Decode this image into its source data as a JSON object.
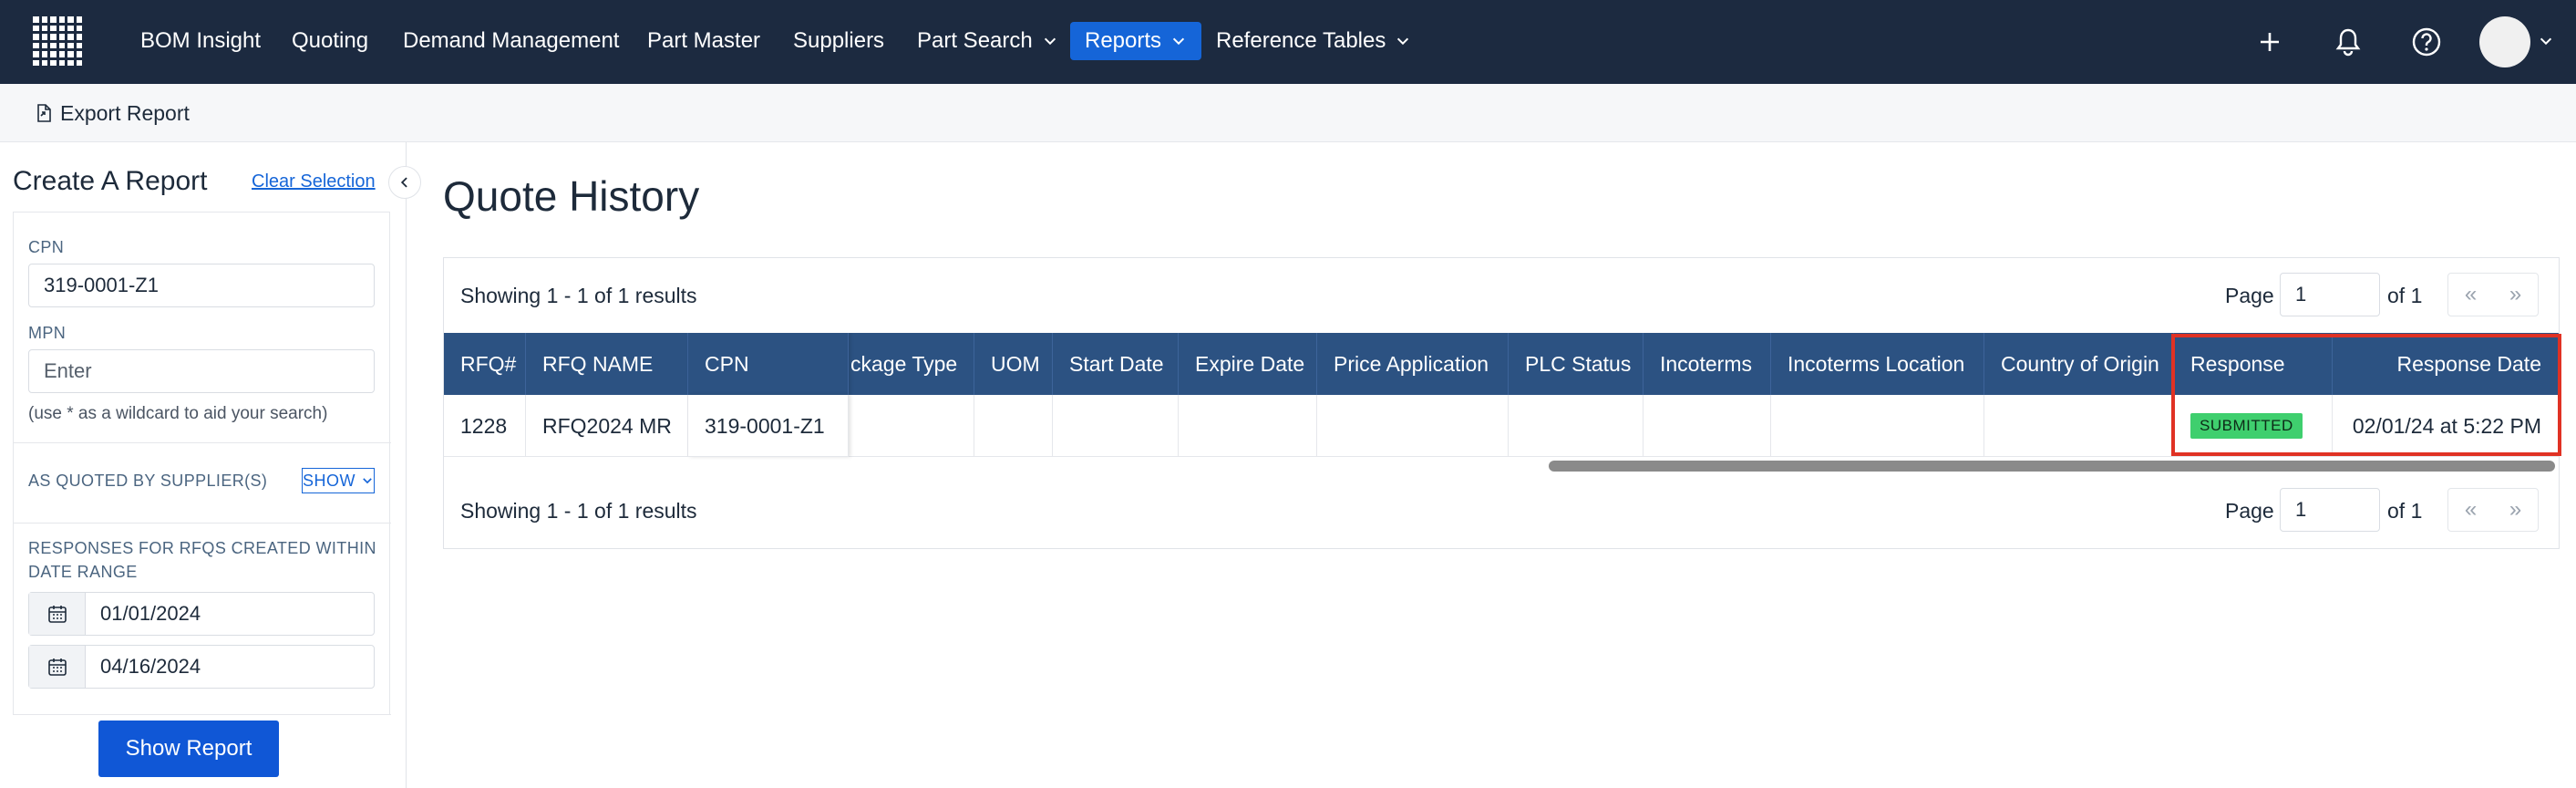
{
  "nav": {
    "items": [
      {
        "label": "BOM Insight"
      },
      {
        "label": "Quoting"
      },
      {
        "label": "Demand Management"
      },
      {
        "label": "Part Master"
      },
      {
        "label": "Suppliers"
      },
      {
        "label": "Part Search"
      },
      {
        "label": "Reports",
        "active": true
      },
      {
        "label": "Reference Tables"
      }
    ],
    "icons": [
      "plus-icon",
      "bell-icon",
      "help-icon",
      "avatar"
    ],
    "accent_color": "#1565d8",
    "bar_color": "#1c2a40"
  },
  "toolbar": {
    "export_label": "Export Report"
  },
  "sidebar": {
    "title": "Create A Report",
    "clear_label": "Clear Selection",
    "cpn": {
      "label": "CPN",
      "value": "319-0001-Z1"
    },
    "mpn": {
      "label": "MPN",
      "placeholder": "Enter",
      "hint": "(use * as a wildcard to aid your search)"
    },
    "quoted_by": {
      "label": "AS QUOTED BY SUPPLIER(S)",
      "toggle_label": "SHOW"
    },
    "date_range": {
      "label_line1": "RESPONSES FOR RFQS CREATED WITHIN",
      "label_line2": "DATE RANGE",
      "start": "01/01/2024",
      "end": "04/16/2024"
    },
    "submit_label": "Show Report"
  },
  "main": {
    "title": "Quote History",
    "showing_top": "Showing 1 - 1 of 1 results",
    "showing_bottom": "Showing 1 - 1 of 1 results",
    "page_label": "Page",
    "page_value": "1",
    "page_of": "of 1",
    "prev_label": "«",
    "next_label": "»",
    "table": {
      "columns": [
        "RFQ#",
        "RFQ NAME",
        "CPN",
        "ckage Type",
        "UOM",
        "Start Date",
        "Expire Date",
        "Price Application",
        "PLC Status",
        "Incoterms",
        "Incoterms Location",
        "Country of Origin",
        "Response",
        "Response Date"
      ],
      "rows": [
        {
          "rfq": "1228",
          "rfq_name": "RFQ2024 MR",
          "cpn": "319-0001-Z1",
          "package_type": "",
          "uom": "",
          "start_date": "",
          "expire_date": "",
          "price_application": "",
          "plc_status": "",
          "incoterms": "",
          "incoterms_location": "",
          "country_of_origin": "",
          "response": "SUBMITTED",
          "response_date": "02/01/24 at 5:22 PM"
        }
      ]
    },
    "header_color": "#2c5282",
    "status_color": "#3fcf6e",
    "highlight_color": "#e03224"
  }
}
